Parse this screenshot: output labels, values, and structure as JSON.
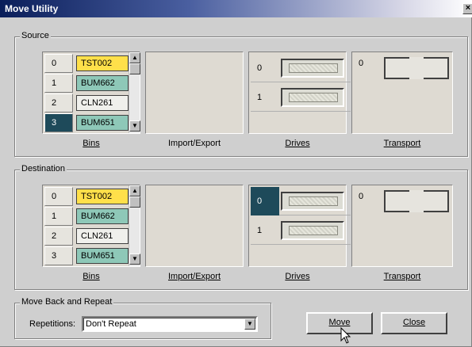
{
  "window": {
    "title": "Move Utility",
    "close_glyph": "×"
  },
  "source": {
    "label": "Source",
    "bins": [
      {
        "num": "0",
        "tag": "TST002",
        "color": "yellow",
        "selected": false
      },
      {
        "num": "1",
        "tag": "BUM662",
        "color": "teal",
        "selected": false
      },
      {
        "num": "2",
        "tag": "CLN261",
        "color": "white",
        "selected": false
      },
      {
        "num": "3",
        "tag": "BUM651",
        "color": "teal",
        "selected": true
      }
    ],
    "captions": {
      "bins": "Bins",
      "import_export": "Import/Export",
      "drives": "Drives",
      "transport": "Transport"
    },
    "drives": [
      {
        "num": "0",
        "selected": false
      },
      {
        "num": "1",
        "selected": false
      }
    ],
    "transport_num": "0"
  },
  "destination": {
    "label": "Destination",
    "bins": [
      {
        "num": "0",
        "tag": "TST002",
        "color": "yellow",
        "selected": false
      },
      {
        "num": "1",
        "tag": "BUM662",
        "color": "teal",
        "selected": false
      },
      {
        "num": "2",
        "tag": "CLN261",
        "color": "white",
        "selected": false
      },
      {
        "num": "3",
        "tag": "BUM651",
        "color": "teal",
        "selected": false
      }
    ],
    "captions": {
      "bins": "Bins",
      "import_export": "Import/Export",
      "drives": "Drives",
      "transport": "Transport"
    },
    "drives": [
      {
        "num": "0",
        "selected": true
      },
      {
        "num": "1",
        "selected": false
      }
    ],
    "transport_num": "0"
  },
  "repeat": {
    "label": "Move Back and Repeat",
    "repetitions_label": "Repetitions:",
    "repetitions_value": "Don't Repeat"
  },
  "buttons": {
    "move": "Move",
    "close": "Close"
  },
  "colors": {
    "selected": "#1e4a5a",
    "tag_yellow": "#ffe04a",
    "tag_teal": "#8ec8b8",
    "titlebar": "#0a1e5a"
  }
}
